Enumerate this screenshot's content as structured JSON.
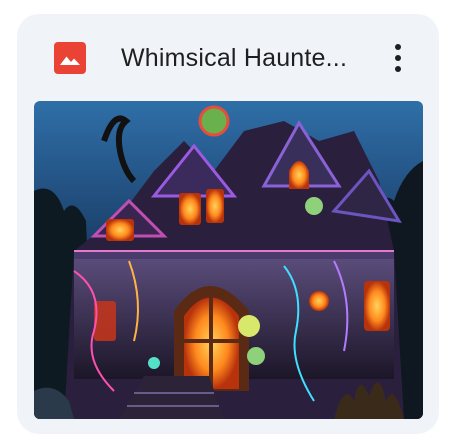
{
  "card": {
    "file_type_icon": "image-icon",
    "title": "Whimsical Haunte...",
    "more_icon": "more-vert-icon",
    "thumbnail_alt": "haunted house illustration thumbnail"
  },
  "colors": {
    "card_background": "#f0f4f9",
    "file_icon_red": "#ea4335",
    "title_text": "#1f1f1f"
  }
}
